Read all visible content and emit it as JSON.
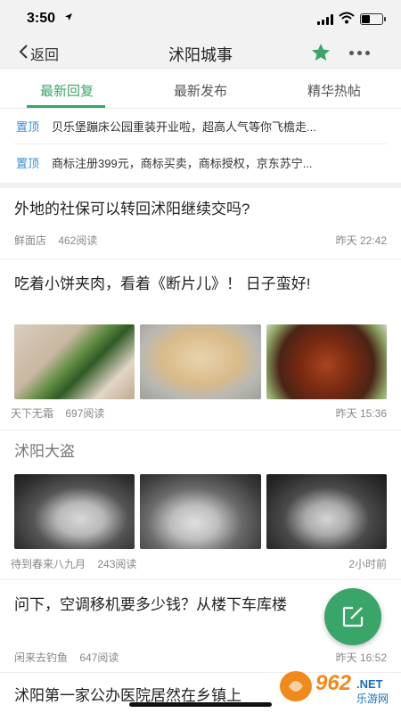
{
  "status": {
    "time": "3:50",
    "location_icon": "location-arrow-icon"
  },
  "nav": {
    "back_label": "返回",
    "title": "沭阳城事",
    "star_color": "#3aa568"
  },
  "tabs": [
    {
      "label": "最新回复",
      "active": true
    },
    {
      "label": "最新发布",
      "active": false
    },
    {
      "label": "精华热帖",
      "active": false
    }
  ],
  "pinned": [
    {
      "tag": "置顶",
      "text": "贝乐堡蹦床公园重装开业啦，超高人气等你飞檐走..."
    },
    {
      "tag": "置顶",
      "text": "商标注册399元，商标买卖，商标授权，京东苏宁..."
    }
  ],
  "posts": [
    {
      "title": "外地的社保可以转回沭阳继续交吗?",
      "author": "鲜面店",
      "reads": "462阅读",
      "time": "昨天 22:42"
    },
    {
      "title": "吃着小饼夹肉，看着《断片儿》！ 日子蛮好!",
      "author": "天下无霜",
      "reads": "697阅读",
      "time": "昨天 15:36"
    },
    {
      "title": "沭阳大盗",
      "author": "待到春来八九月",
      "reads": "243阅读",
      "time": "2小时前"
    },
    {
      "title": "问下，空调移机要多少钱？从楼下车库楼",
      "author": "闲来去钓鱼",
      "reads": "647阅读",
      "time": "昨天 16:52"
    },
    {
      "title": "沭阳第一家公办医院居然在乡镇上"
    }
  ],
  "watermark": {
    "text": "962",
    "suffix": ".NET",
    "sub": "乐游网"
  },
  "colors": {
    "accent": "#3aa568",
    "pin": "#3a8ed8"
  }
}
